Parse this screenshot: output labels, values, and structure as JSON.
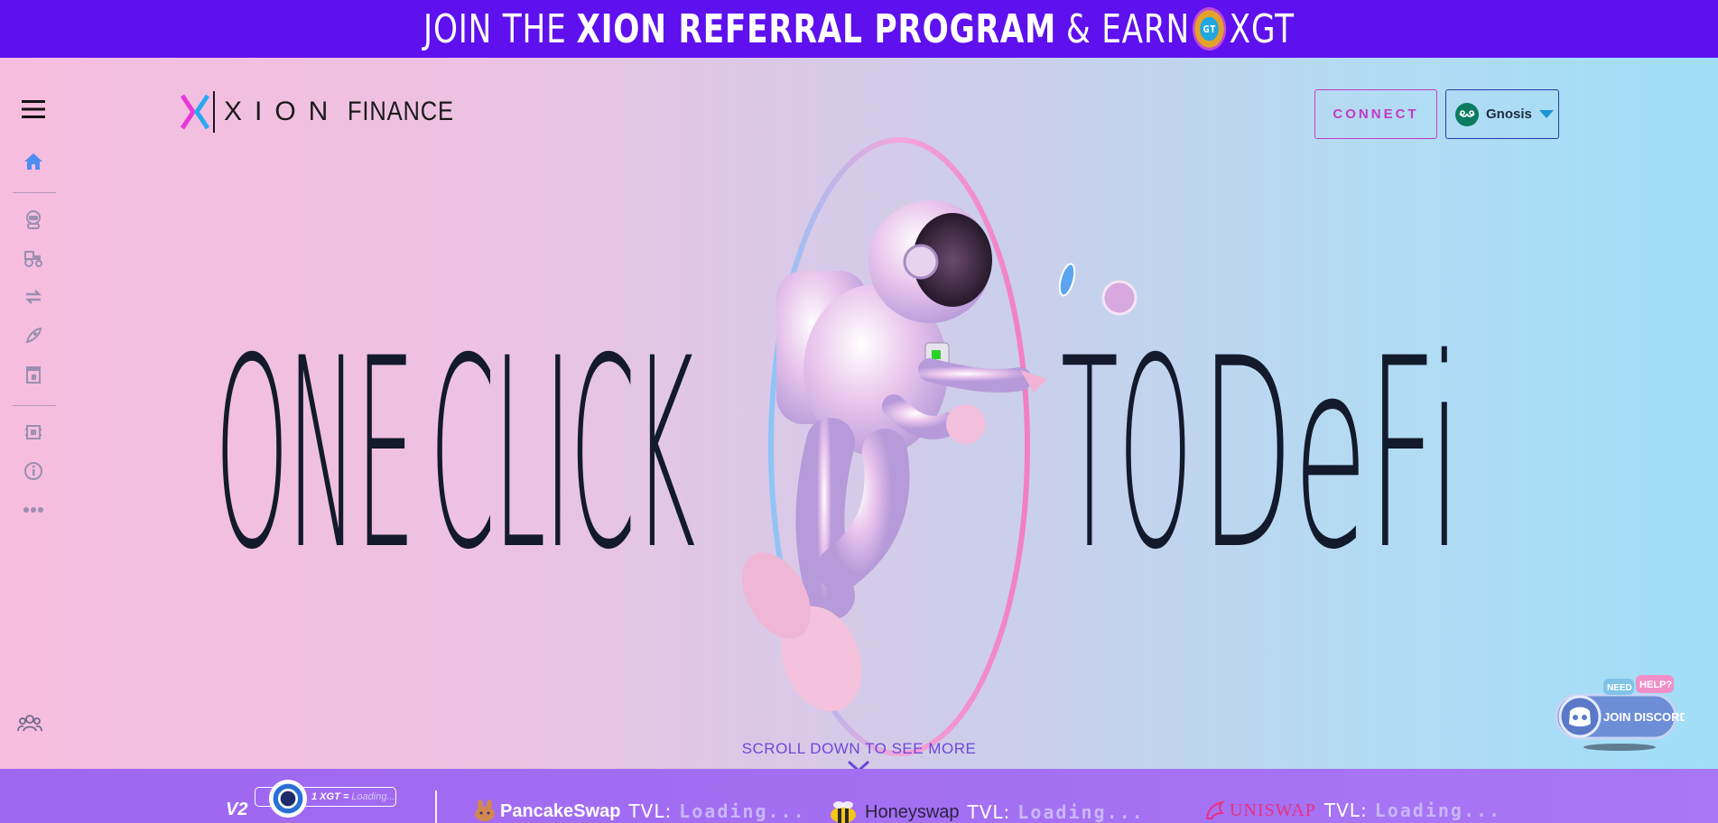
{
  "banner": {
    "part1": "JOIN THE",
    "part2": "XION REFERRAL PROGRAM",
    "part3": "& EARN",
    "coin_label": "GT",
    "part4": "XGT"
  },
  "sidebar": {
    "items": [
      {
        "name": "menu-icon"
      },
      {
        "name": "home-icon"
      },
      {
        "name": "astronaut-icon"
      },
      {
        "name": "farm-tractor-icon"
      },
      {
        "name": "swap-icon"
      },
      {
        "name": "rocket-icon"
      },
      {
        "name": "store-icon"
      },
      {
        "name": "chip-icon"
      },
      {
        "name": "info-icon"
      },
      {
        "name": "more-icon"
      },
      {
        "name": "community-icon"
      }
    ]
  },
  "header": {
    "logo_xion": "XION",
    "logo_finance": "FINANCE",
    "connect_label": "CONNECT",
    "network_label": "Gnosis"
  },
  "hero": {
    "word_one": "ONE",
    "word_click": "CLICK",
    "word_to": "TO",
    "word_defi": "DeFi",
    "scroll_hint": "SCROLL DOWN TO SEE MORE"
  },
  "ticker": {
    "version": "V2",
    "price_label": "1 XGT =",
    "price_value": "Loading...",
    "dexes": [
      {
        "name": "PancakeSwap",
        "tvl_label": "TVL:",
        "tvl_value": "Loading..."
      },
      {
        "name": "Honeyswap",
        "tvl_label": "TVL:",
        "tvl_value": "Loading..."
      },
      {
        "name": "UNISWAP",
        "tvl_label": "TVL:",
        "tvl_value": "Loading..."
      }
    ]
  },
  "discord": {
    "need": "NEED",
    "help": "HELP?",
    "label": "JOIN DISCORD"
  },
  "colors": {
    "banner": "#5e10ee",
    "connect": "#c23ac7",
    "network_border": "#2a3aa8",
    "ticker": "#a370f2"
  }
}
